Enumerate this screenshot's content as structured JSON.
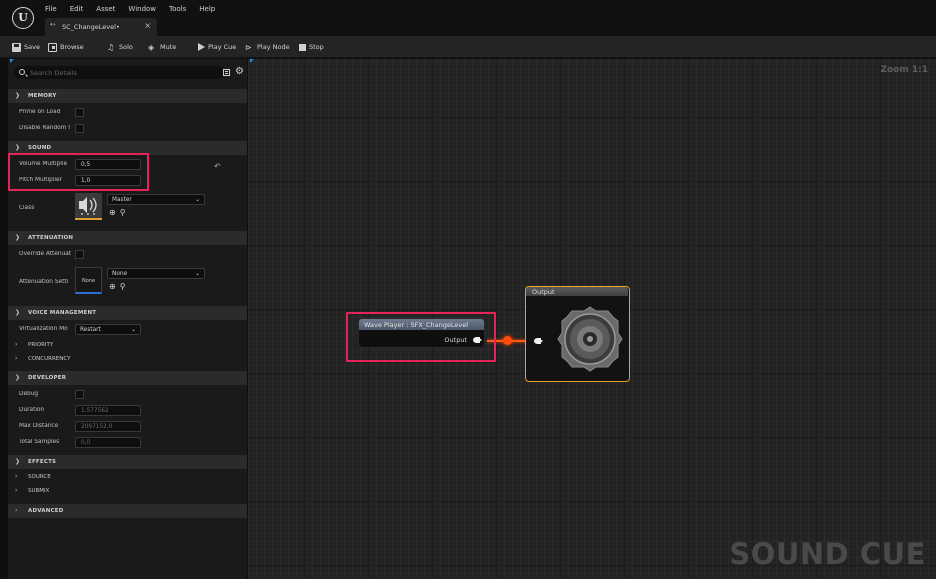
{
  "app": {
    "logo_text": "U",
    "menu": [
      "File",
      "Edit",
      "Asset",
      "Window",
      "Tools",
      "Help"
    ],
    "doc_tab": {
      "label": "SC_ChangeLevel•",
      "close": "×",
      "icon": "⁴⁺"
    }
  },
  "toolbar": {
    "save": "Save",
    "browse": "Browse",
    "solo": "Solo",
    "mute": "Mute",
    "play_cue": "Play Cue",
    "play_node": "Play Node",
    "stop": "Stop"
  },
  "details": {
    "search_placeholder": "Search Details",
    "sections": {
      "memory": "MEMORY",
      "sound": "SOUND",
      "attenuation": "ATTENUATION",
      "voice_management": "VOICE MANAGEMENT",
      "developer": "DEVELOPER",
      "effects": "EFFECTS",
      "advanced": "ADVANCED"
    },
    "subsections": {
      "priority": "PRIORITY",
      "concurrency": "CONCURRENCY",
      "source": "SOURCE",
      "submix": "SUBMIX"
    },
    "memory": {
      "prime_on_load": "Prime on Load",
      "disable_random": "Disable Random I"
    },
    "sound": {
      "volume_label": "Volume Multiplie",
      "volume_value": "0,5",
      "pitch_label": "Pitch Multiplier",
      "pitch_value": "1,0",
      "class_label": "Class",
      "class_value": "Master"
    },
    "attenuation": {
      "override_label": "Override Attenuat",
      "settings_label": "Attenuation Setti",
      "thumb_text": "None",
      "settings_value": "None"
    },
    "voice": {
      "virtualization_label": "Virtualization Mo",
      "virtualization_value": "Restart"
    },
    "developer": {
      "debug_label": "Debug",
      "duration_label": "Duration",
      "duration_value": "1,577562",
      "max_distance_label": "Max Distance",
      "max_distance_value": "2097152,0",
      "total_samples_label": "Total Samples",
      "total_samples_value": "0,0"
    }
  },
  "graph": {
    "zoom": "Zoom 1:1",
    "watermark": "SOUND CUE",
    "wave_node": {
      "title": "Wave Player : SFX_ChangeLevel",
      "pin": "Output"
    },
    "output_node": {
      "title": "Output"
    }
  },
  "colors": {
    "accent_blue": "#2e8bd8",
    "highlight": "#e5245a",
    "wire": "#ff5a14",
    "output_border": "#e8a020"
  }
}
